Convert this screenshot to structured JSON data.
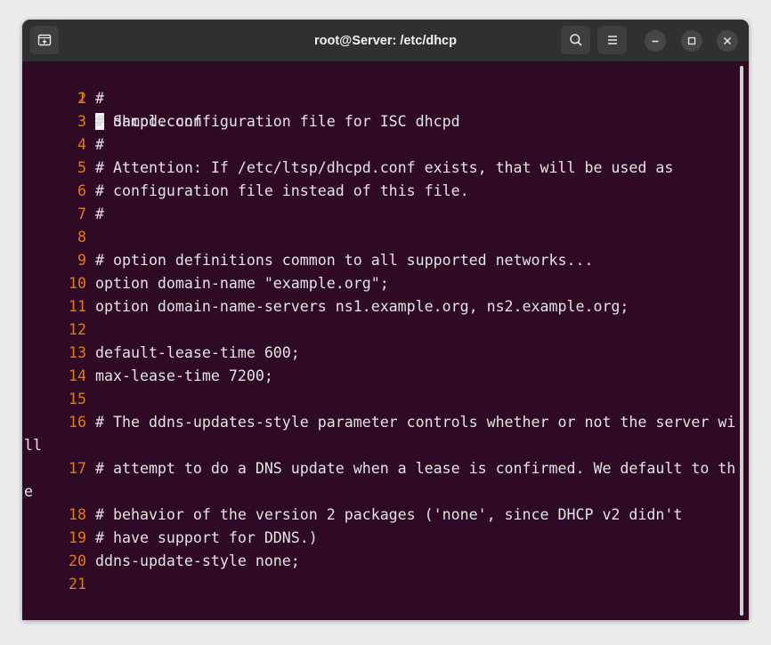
{
  "window": {
    "title": "root@Server: /etc/dhcp"
  },
  "icons": {
    "new_tab": "new-tab-icon",
    "search": "search-icon",
    "menu": "hamburger-menu-icon",
    "minimize": "minimize-icon",
    "maximize": "maximize-icon",
    "close": "close-icon"
  },
  "colors": {
    "background": "#2f0a24",
    "line_numbers": "#e07a1f",
    "text": "#e3e3e3",
    "titlebar": "#303030"
  },
  "editor": {
    "cursor_char": "#",
    "rows": [
      {
        "num": "1",
        "text": " dhcpd.conf"
      },
      {
        "num": "2",
        "text": "#"
      },
      {
        "num": "3",
        "text": "# Sample configuration file for ISC dhcpd"
      },
      {
        "num": "4",
        "text": "#"
      },
      {
        "num": "5",
        "text": "# Attention: If /etc/ltsp/dhcpd.conf exists, that will be used as"
      },
      {
        "num": "6",
        "text": "# configuration file instead of this file."
      },
      {
        "num": "7",
        "text": "#"
      },
      {
        "num": "8",
        "text": ""
      },
      {
        "num": "9",
        "text": "# option definitions common to all supported networks..."
      },
      {
        "num": "10",
        "text": "option domain-name \"example.org\";"
      },
      {
        "num": "11",
        "text": "option domain-name-servers ns1.example.org, ns2.example.org;"
      },
      {
        "num": "12",
        "text": ""
      },
      {
        "num": "13",
        "text": "default-lease-time 600;"
      },
      {
        "num": "14",
        "text": "max-lease-time 7200;"
      },
      {
        "num": "15",
        "text": ""
      },
      {
        "num": "16",
        "text": "# The ddns-updates-style parameter controls whether or not the server wi"
      },
      {
        "num": "",
        "text": "ll"
      },
      {
        "num": "17",
        "text": "# attempt to do a DNS update when a lease is confirmed. We default to th"
      },
      {
        "num": "",
        "text": "e"
      },
      {
        "num": "18",
        "text": "# behavior of the version 2 packages ('none', since DHCP v2 didn't"
      },
      {
        "num": "19",
        "text": "# have support for DDNS.)"
      },
      {
        "num": "20",
        "text": "ddns-update-style none;"
      },
      {
        "num": "21",
        "text": ""
      }
    ]
  }
}
